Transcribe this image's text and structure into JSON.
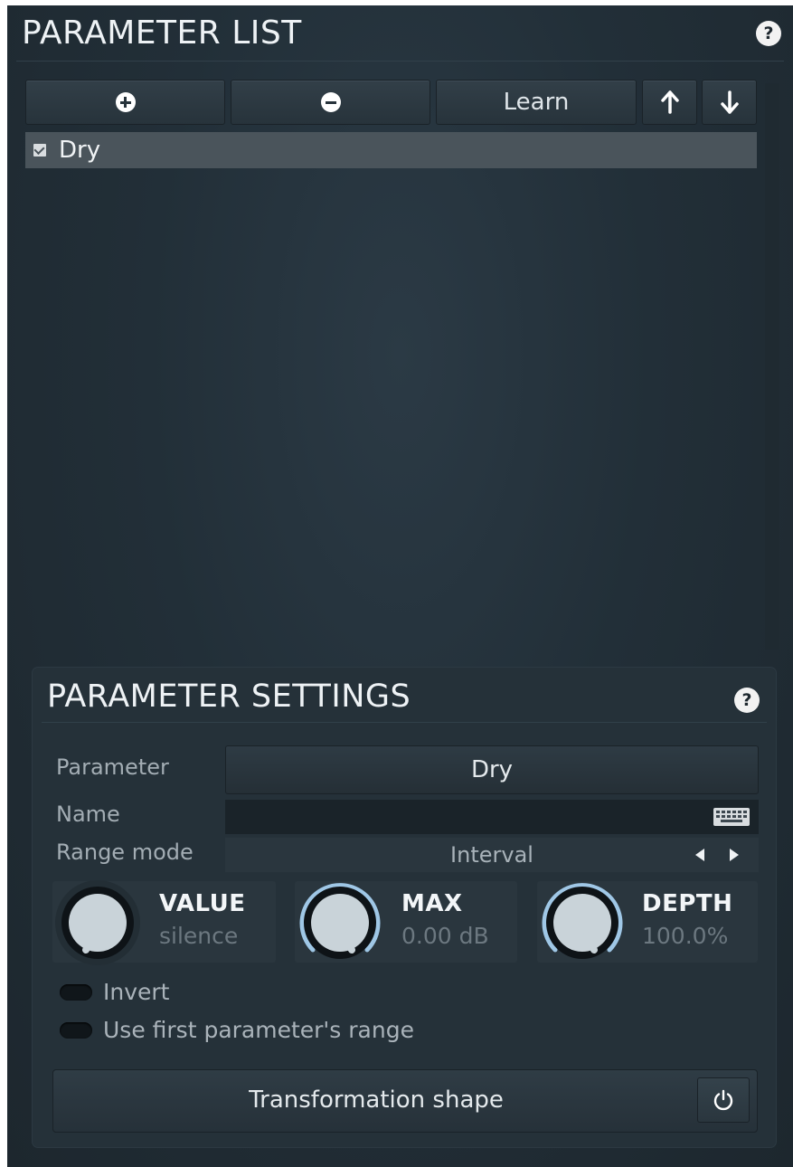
{
  "header": {
    "title": "PARAMETER LIST",
    "help_label": "?"
  },
  "toolbar": {
    "add_icon": "plus-circle-icon",
    "remove_icon": "minus-circle-icon",
    "learn_label": "Learn",
    "up_icon": "arrow-up-icon",
    "down_icon": "arrow-down-icon"
  },
  "parameter_list": {
    "items": [
      {
        "label": "Dry",
        "checked": true
      }
    ]
  },
  "settings": {
    "title": "PARAMETER SETTINGS",
    "help_label": "?",
    "parameter_label": "Parameter",
    "parameter_value": "Dry",
    "name_label": "Name",
    "name_value": "",
    "range_mode_label": "Range mode",
    "range_mode_value": "Interval",
    "knobs": [
      {
        "title": "VALUE",
        "value": "silence",
        "position": 0.0
      },
      {
        "title": "MAX",
        "value": "0.00 dB",
        "position": 1.0
      },
      {
        "title": "DEPTH",
        "value": "100.0%",
        "position": 1.0
      }
    ],
    "invert_label": "Invert",
    "invert_on": false,
    "use_first_label": "Use first parameter's range",
    "use_first_on": false,
    "transformation_label": "Transformation shape",
    "power_icon": "power-icon"
  },
  "colors": {
    "background": "#222f38",
    "accent_ring": "#9fc7e6",
    "knob_face": "#c9d3d9",
    "selected_row": "#4a545b"
  }
}
